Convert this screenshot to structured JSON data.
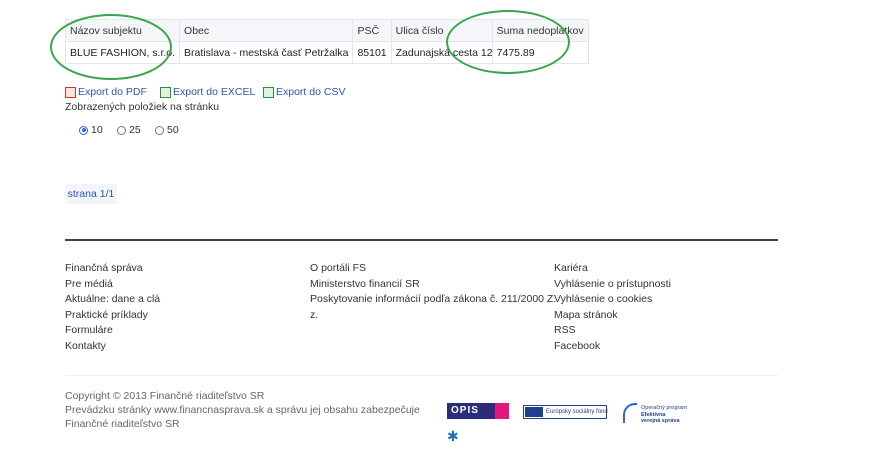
{
  "table": {
    "headers": [
      "Názov subjektu",
      "Obec",
      "PSČ",
      "Ulica číslo",
      "Suma nedoplatkov"
    ],
    "row": [
      "BLUE FASHION, s.r.o.",
      "Bratislava - mestská časť Petržalka",
      "85101",
      "Zadunajská cesta 12",
      "7475.89"
    ]
  },
  "exports": {
    "pdf": "Export do PDF",
    "excel": "Export do EXCEL",
    "csv": "Export do CSV"
  },
  "page_size": {
    "label": "Zobrazených položiek na stránku",
    "options": [
      "10",
      "25",
      "50"
    ],
    "selected": "10"
  },
  "pager": "strana 1/1",
  "footer": {
    "col1": [
      "Finančná správa",
      "Pre médiá",
      "Aktuálne: dane a clá",
      "Praktické príklady",
      "Formuláre",
      "Kontakty"
    ],
    "col2": [
      "O portáli FS",
      "Ministerstvo financií SR",
      "Poskytovanie informácií podľa zákona č. 211/2000 Z.",
      "z."
    ],
    "col3": [
      "Kariéra",
      "Vyhlásenie o prístupnosti",
      "Vyhlásenie o cookies",
      "Mapa stránok",
      "RSS",
      "Facebook"
    ],
    "copyright": [
      "Copyright © 2013 Finančné riaditeľstvo SR",
      "Prevádzku stránky www.financnasprava.sk a správu jej obsahu zabezpečuje",
      "Finančné riaditeľstvo SR"
    ]
  },
  "logos": {
    "opis": "OPIS",
    "eu": "Európsky sociálny fond",
    "ovs": [
      "Operačný program",
      "Efektívna",
      "verejná správa"
    ]
  },
  "colors": {
    "link": "#2a57a8",
    "highlight": "#3aa64b",
    "rule": "#2d4463"
  }
}
